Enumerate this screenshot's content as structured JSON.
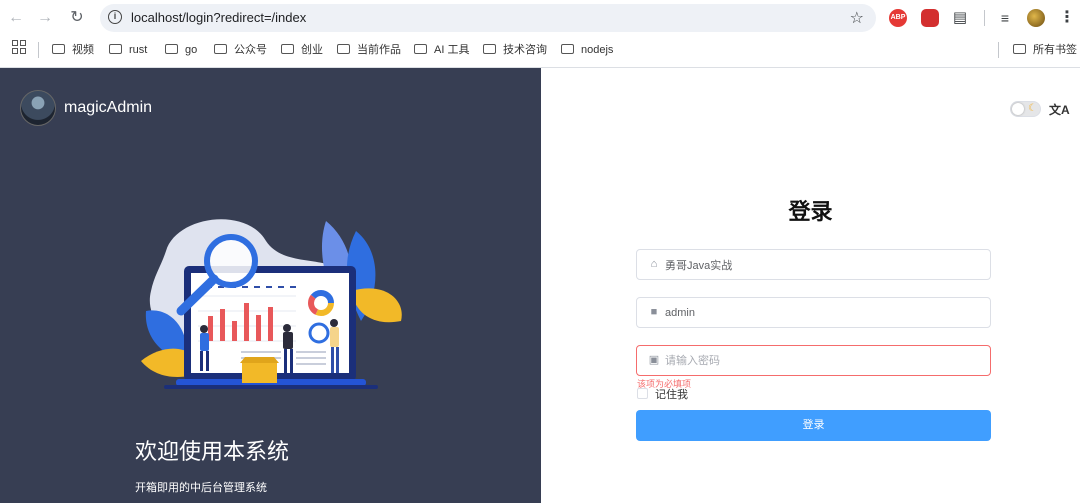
{
  "browser": {
    "url": "localhost/login?redirect=/index",
    "bookmarks": [
      "视频",
      "rust",
      "go",
      "公众号",
      "创业",
      "当前作品",
      "AI 工具",
      "技术咨询",
      "nodejs"
    ],
    "other_bookmarks": "所有书签",
    "ext_abp": "ABP"
  },
  "brand": {
    "name": "magicAdmin"
  },
  "welcome": {
    "title": "欢迎使用本系统",
    "subtitle": "开箱即用的中后台管理系统"
  },
  "login": {
    "title": "登录",
    "tenant_value": "勇哥Java实战",
    "username_value": "admin",
    "password_placeholder": "请输入密码",
    "password_error": "该项为必填项",
    "remember_label": "记住我",
    "submit_label": "登录"
  },
  "icons": {
    "tenant": "home-icon",
    "user": "user-icon",
    "password": "lock-icon",
    "theme": "moon-icon",
    "language": "translate-icon"
  },
  "colors": {
    "left_bg": "#373e53",
    "primary": "#409eff",
    "error": "#f56c6c"
  }
}
